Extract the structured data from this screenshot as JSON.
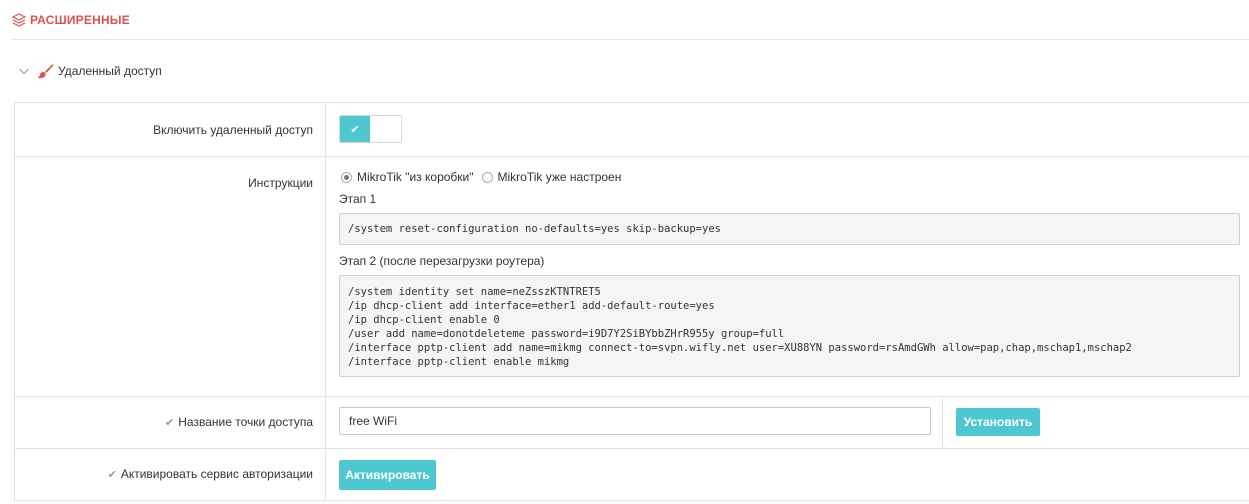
{
  "page": {
    "title": "РАСШИРЕННЫЕ",
    "title_icon": "layers-icon"
  },
  "section": {
    "label": "Удаленный доступ",
    "icons": [
      "chevron-down-icon",
      "paintbrush-icon"
    ]
  },
  "rows": {
    "remote_access": {
      "label": "Включить удаленный доступ",
      "toggle_state": "on",
      "toggle_glyph": "✔"
    },
    "instructions": {
      "label": "Инструкции",
      "options": [
        {
          "label": "MikroTik \"из коробки\"",
          "selected": true
        },
        {
          "label": "MikroTik уже настроен",
          "selected": false
        }
      ],
      "stage1_title": "Этап 1",
      "stage1_code": "/system reset-configuration no-defaults=yes skip-backup=yes",
      "stage2_title": "Этап 2 (после перезагрузки роутера)",
      "stage2_code": "/system identity set name=neZsszKTNTRET5\n/ip dhcp-client add interface=ether1 add-default-route=yes\n/ip dhcp-client enable 0\n/user add name=donotdeleteme password=i9D7Y2SiBYbbZHrR955y group=full\n/interface pptp-client add name=mikmg connect-to=svpn.wifly.net user=XU88YN password=rsAmdGWh allow=pap,chap,mschap1,mschap2\n/interface pptp-client enable mikmg"
    },
    "ssid": {
      "check": "✔",
      "label": "Название точки доступа",
      "value": "free WiFi",
      "button": "Установить"
    },
    "auth": {
      "check": "✔",
      "label": "Активировать сервис авторизации",
      "button": "Активировать"
    }
  },
  "colors": {
    "accent": "#4ec7d1",
    "title_red": "#d9534f"
  }
}
